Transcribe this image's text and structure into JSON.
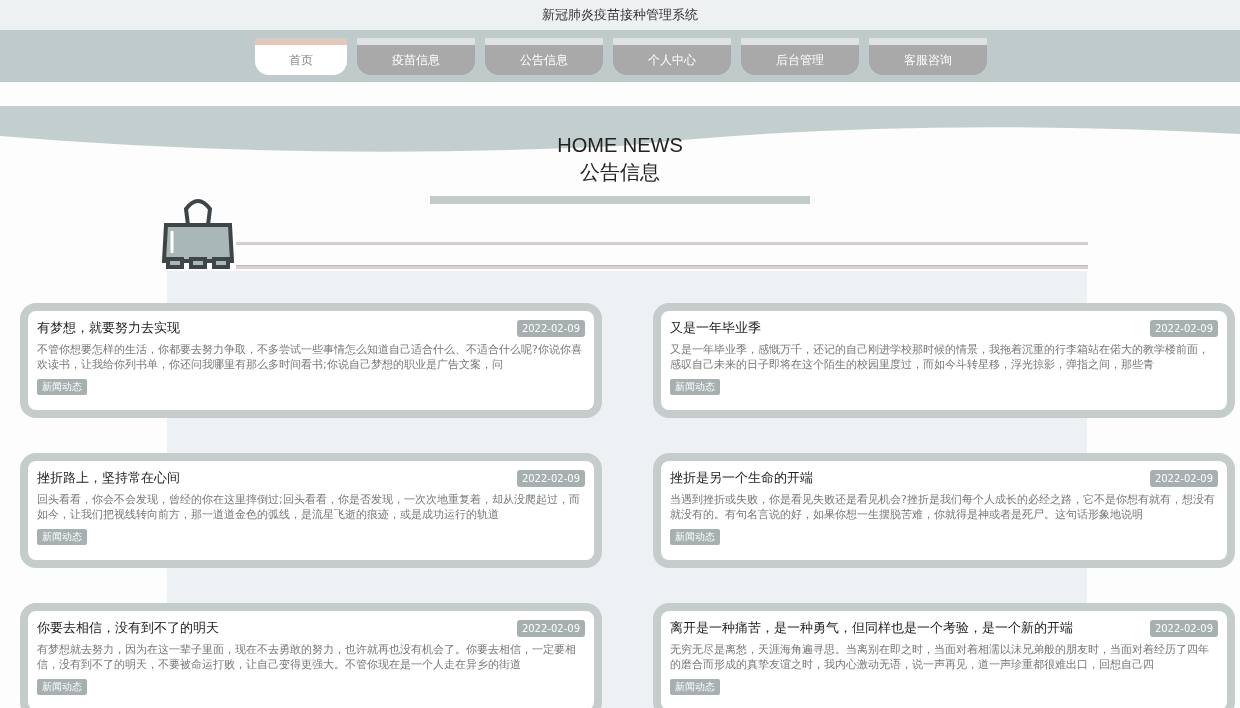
{
  "site_title": "新冠肺炎疫苗接种管理系统",
  "nav": [
    {
      "label": "首页",
      "selected": true
    },
    {
      "label": "疫苗信息",
      "selected": false
    },
    {
      "label": "公告信息",
      "selected": false
    },
    {
      "label": "个人中心",
      "selected": false
    },
    {
      "label": "后台管理",
      "selected": false
    },
    {
      "label": "客服咨询",
      "selected": false
    }
  ],
  "section": {
    "title_en": "HOME NEWS",
    "title": "公告信息"
  },
  "news": [
    {
      "title": "有梦想，就要努力去实现",
      "date": "2022-02-09",
      "excerpt": "不管你想要怎样的生活，你都要去努力争取，不多尝试一些事情怎么知道自己适合什么、不适合什么呢?你说你喜欢读书，让我给你列书单，你还问我哪里有那么多时间看书;你说自己梦想的职业是广告文案，问",
      "tag": "新闻动态"
    },
    {
      "title": "又是一年毕业季",
      "date": "2022-02-09",
      "excerpt": "又是一年毕业季，感慨万千，还记的自己刚进学校那时候的情景，我拖着沉重的行李箱站在偌大的教学楼前面，感叹自己未来的日子即将在这个陌生的校园里度过，而如今斗转星移，浮光掠影，弹指之间，那些青",
      "tag": "新闻动态"
    },
    {
      "title": "挫折路上，坚持常在心间",
      "date": "2022-02-09",
      "excerpt": "回头看看，你会不会发现，曾经的你在这里摔倒过;回头看看，你是否发现，一次次地重复着，却从没爬起过，而如今，让我们把视线转向前方，那一道道金色的弧线，是流星飞逝的痕迹，或是成功运行的轨道",
      "tag": "新闻动态"
    },
    {
      "title": "挫折是另一个生命的开端",
      "date": "2022-02-09",
      "excerpt": "当遇到挫折或失败，你是看见失败还是看见机会?挫折是我们每个人成长的必经之路，它不是你想有就有，想没有就没有的。有句名言说的好，如果你想一生摆脱苦难，你就得是神或者是死尸。这句话形象地说明",
      "tag": "新闻动态"
    },
    {
      "title": "你要去相信，没有到不了的明天",
      "date": "2022-02-09",
      "excerpt": "有梦想就去努力，因为在这一辈子里面，现在不去勇敢的努力，也许就再也没有机会了。你要去相信，一定要相信，没有到不了的明天，不要被命运打败，让自己变得更强大。不管你现在是一个人走在异乡的街道",
      "tag": "新闻动态"
    },
    {
      "title": "离开是一种痛苦，是一种勇气，但同样也是一个考验，是一个新的开端",
      "date": "2022-02-09",
      "excerpt": "无穷无尽是离愁，天涯海角遍寻思。当离别在即之时，当面对着相濡以沫兄弟般的朋友时，当面对着经历了四年的磨合而形成的真挚友谊之时，我内心激动无语，说一声再见，道一声珍重都很难出口，回想自己四",
      "tag": "新闻动态"
    }
  ]
}
